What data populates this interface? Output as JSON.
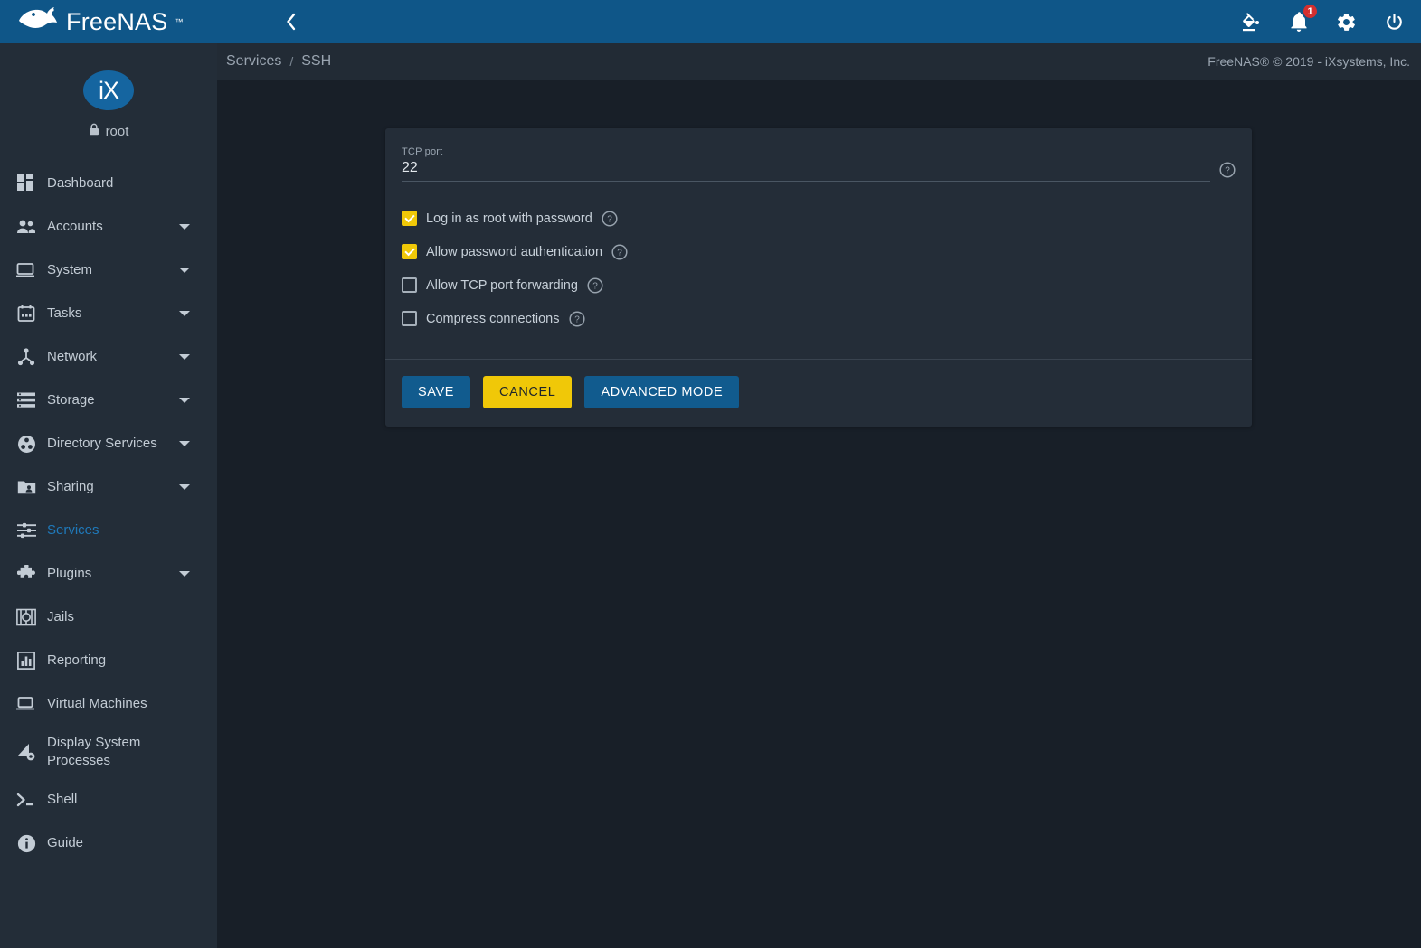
{
  "brand": {
    "name": "FreeNAS",
    "tm": "™",
    "logo_icon": "freenas-fish-logo"
  },
  "topbar": {
    "menu_icon": "hamburger-menu-icon",
    "back_icon": "chevron-left-icon",
    "theme_icon": "paint-bucket-icon",
    "notifications_icon": "bell-icon",
    "notifications_count": "1",
    "settings_icon": "gear-icon",
    "power_icon": "power-icon"
  },
  "sidebar": {
    "avatar_text": "iX",
    "user": "root",
    "user_icon": "lock-icon",
    "items": [
      {
        "label": "Dashboard",
        "icon": "dashboard-grid-icon",
        "expandable": false,
        "active": false
      },
      {
        "label": "Accounts",
        "icon": "people-icon",
        "expandable": true,
        "active": false
      },
      {
        "label": "System",
        "icon": "monitor-icon",
        "expandable": true,
        "active": false
      },
      {
        "label": "Tasks",
        "icon": "calendar-icon",
        "expandable": true,
        "active": false
      },
      {
        "label": "Network",
        "icon": "network-nodes-icon",
        "expandable": true,
        "active": false
      },
      {
        "label": "Storage",
        "icon": "storage-stack-icon",
        "expandable": true,
        "active": false
      },
      {
        "label": "Directory Services",
        "icon": "directory-services-icon",
        "expandable": true,
        "active": false
      },
      {
        "label": "Sharing",
        "icon": "sharing-folder-icon",
        "expandable": true,
        "active": false
      },
      {
        "label": "Services",
        "icon": "sliders-icon",
        "expandable": false,
        "active": true
      },
      {
        "label": "Plugins",
        "icon": "puzzle-piece-icon",
        "expandable": true,
        "active": false
      },
      {
        "label": "Jails",
        "icon": "jail-cell-icon",
        "expandable": false,
        "active": false
      },
      {
        "label": "Reporting",
        "icon": "bar-chart-icon",
        "expandable": false,
        "active": false
      },
      {
        "label": "Virtual Machines",
        "icon": "laptop-icon",
        "expandable": false,
        "active": false
      },
      {
        "label": "Display System Processes",
        "icon": "processes-gear-icon",
        "expandable": false,
        "active": false
      },
      {
        "label": "Shell",
        "icon": "terminal-prompt-icon",
        "expandable": false,
        "active": false
      },
      {
        "label": "Guide",
        "icon": "info-circle-icon",
        "expandable": false,
        "active": false
      }
    ]
  },
  "breadcrumb": {
    "items": [
      "Services",
      "SSH"
    ],
    "separator": "/",
    "copyright": "FreeNAS® © 2019 - iXsystems, Inc."
  },
  "form": {
    "tcp_port": {
      "label": "TCP port",
      "value": "22",
      "placeholder": "",
      "help_icon": "help-circle-icon"
    },
    "checkboxes": [
      {
        "label": "Log in as root with password",
        "checked": true,
        "help_icon": "help-circle-icon"
      },
      {
        "label": "Allow password authentication",
        "checked": true,
        "help_icon": "help-circle-icon"
      },
      {
        "label": "Allow TCP port forwarding",
        "checked": false,
        "help_icon": "help-circle-icon"
      },
      {
        "label": "Compress connections",
        "checked": false,
        "help_icon": "help-circle-icon"
      }
    ],
    "buttons": {
      "save": "SAVE",
      "cancel": "CANCEL",
      "advanced": "ADVANCED MODE"
    }
  },
  "colors": {
    "header_blue": "#0f5688",
    "sidebar_bg": "#232d38",
    "page_bg": "#181f28",
    "card_bg": "#242d38",
    "accent_blue": "#115b8e",
    "accent_yellow": "#f0c808",
    "active_link": "#1f79ba",
    "badge_red": "#d32f2f"
  }
}
